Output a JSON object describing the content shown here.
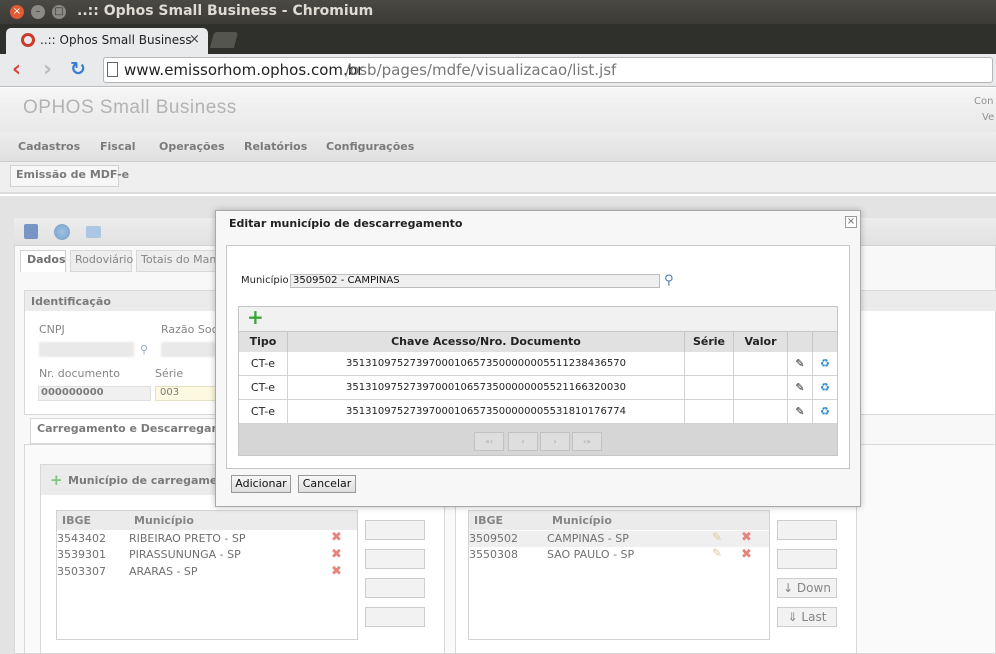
{
  "window": {
    "title": "..:: Ophos Small Business - Chromium"
  },
  "browser": {
    "tab_title": "..:: Ophos Small Business",
    "url_host": "www.emissorhom.ophos.com.br",
    "url_path": "/osb/pages/mdfe/visualizacao/list.jsf"
  },
  "app": {
    "title": "OPHOS Small Business",
    "header_right": [
      "Con",
      "Ve"
    ],
    "menu": [
      "Cadastros",
      "Fiscal",
      "Operações",
      "Relatórios",
      "Configurações"
    ],
    "page_tab": "Emissão de MDF-e"
  },
  "form": {
    "tabs": [
      "Dados",
      "Rodoviário",
      "Totais do Manif"
    ],
    "identificacao": "Identificação",
    "cnpj_label": "CNPJ",
    "razao_label": "Razão Soc",
    "nr_doc_label": "Nr. documento",
    "nr_doc_value": "000000000",
    "serie_label": "Série",
    "serie_value": "003",
    "carregamento_tab": "Carregamento e Descarregamento",
    "mun_carregamento": "Município de carregamento",
    "col_ibge": "IBGE",
    "col_municipio": "Município",
    "carregamento_rows": [
      {
        "ibge": "3543402",
        "municipio": "RIBEIRAO PRETO - SP"
      },
      {
        "ibge": "3539301",
        "municipio": "PIRASSUNUNGA - SP"
      },
      {
        "ibge": "3503307",
        "municipio": "ARARAS - SP"
      }
    ],
    "descarregamento_rows": [
      {
        "ibge": "3509502",
        "municipio": "CAMPINAS - SP"
      },
      {
        "ibge": "3550308",
        "municipio": "SAO PAULO - SP"
      }
    ],
    "down_btn": "↓ Down",
    "last_btn": "⇓ Last"
  },
  "dialog": {
    "title": "Editar município de descarregamento",
    "municipio_label": "Município",
    "municipio_value": "3509502 - CAMPINAS",
    "headers": {
      "tipo": "Tipo",
      "chave": "Chave Acesso/Nro. Documento",
      "serie": "Série",
      "valor": "Valor"
    },
    "rows": [
      {
        "tipo": "CT-e",
        "chave": "35131097527397000106573500000005511238436570"
      },
      {
        "tipo": "CT-e",
        "chave": "35131097527397000106573500000005521166320030"
      },
      {
        "tipo": "CT-e",
        "chave": "35131097527397000106573500000005531810176774"
      }
    ],
    "pager": [
      "«‹",
      "‹",
      "›",
      "›»"
    ],
    "add_button": "Adicionar",
    "cancel_button": "Cancelar"
  },
  "colors": {
    "accent_red": "#d9423c",
    "chrome_dark": "#3b3a36"
  }
}
